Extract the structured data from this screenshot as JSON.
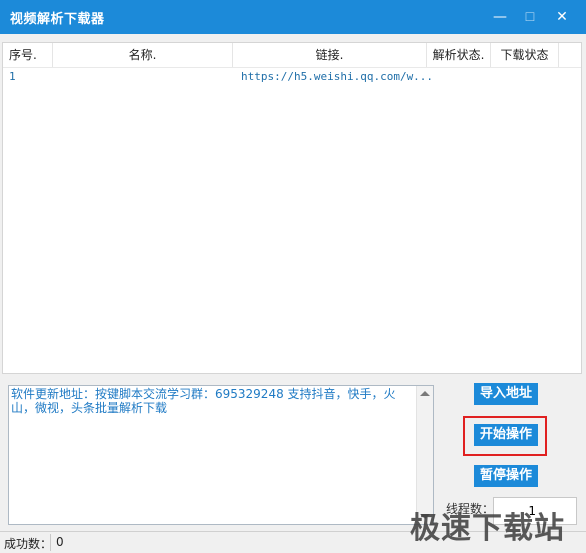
{
  "window": {
    "title": "视频解析下载器",
    "minimize_icon": "minimize-icon",
    "maximize_icon": "maximize-icon",
    "close_icon": "close-icon",
    "min_glyph": "—",
    "max_glyph": "☐",
    "close_glyph": "✕"
  },
  "table": {
    "headers": [
      "序号.",
      "名称.",
      "链接.",
      "解析状态.",
      "下载状态"
    ],
    "rows": [
      [
        "1",
        "",
        "https://h5.weishi.qq.com/w...",
        "",
        ""
      ]
    ]
  },
  "log": {
    "text": "软件更新地址：按键脚本交流学习群：695329248 支持抖音，快手，火山，微视，头条批量解析下载"
  },
  "buttons": {
    "import": "导入地址",
    "start": "开始操作",
    "pause": "暂停操作"
  },
  "threads": {
    "label": "线程数：",
    "value": "1"
  },
  "status": {
    "label": "成功数：",
    "value": "0"
  },
  "watermark": "极速下载站",
  "colors": {
    "accent": "#1c8ad9",
    "highlight": "#e02020"
  }
}
